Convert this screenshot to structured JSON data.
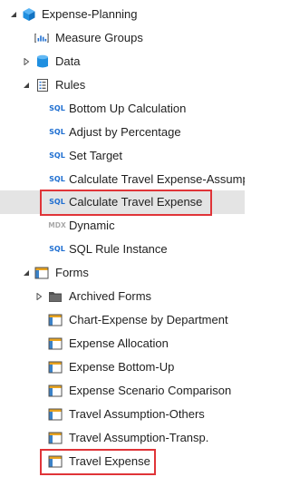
{
  "tree": {
    "root": {
      "label": "Expense-Planning",
      "icon": "cube-icon"
    },
    "measure_groups": {
      "label": "Measure Groups",
      "icon": "measure-groups-icon"
    },
    "data": {
      "label": "Data",
      "icon": "database-icon"
    },
    "rules": {
      "label": "Rules",
      "icon": "rules-document-icon",
      "items": [
        {
          "label": "Bottom Up Calculation",
          "badge": "SQL"
        },
        {
          "label": "Adjust by Percentage",
          "badge": "SQL"
        },
        {
          "label": "Set Target",
          "badge": "SQL"
        },
        {
          "label": "Calculate Travel Expense-Assumptions",
          "badge": "SQL"
        },
        {
          "label": "Calculate Travel Expense",
          "badge": "SQL"
        },
        {
          "label": "Dynamic",
          "badge": "MDX"
        },
        {
          "label": "SQL Rule Instance",
          "badge": "SQL"
        }
      ]
    },
    "forms": {
      "label": "Forms",
      "icon": "form-icon",
      "archived": {
        "label": "Archived Forms",
        "icon": "folder-icon"
      },
      "items": [
        {
          "label": "Chart-Expense by Department"
        },
        {
          "label": "Expense Allocation"
        },
        {
          "label": "Expense Bottom-Up"
        },
        {
          "label": "Expense Scenario Comparison"
        },
        {
          "label": "Travel Assumption-Others"
        },
        {
          "label": "Travel Assumption-Transp."
        },
        {
          "label": "Travel Expense"
        }
      ]
    }
  },
  "colors": {
    "selected_row": "#e4e4e4",
    "highlight_border": "#e03438",
    "sql_badge": "#1f6fd1",
    "mdx_badge": "#a9a9a9",
    "cube": "#1f8fe0"
  }
}
